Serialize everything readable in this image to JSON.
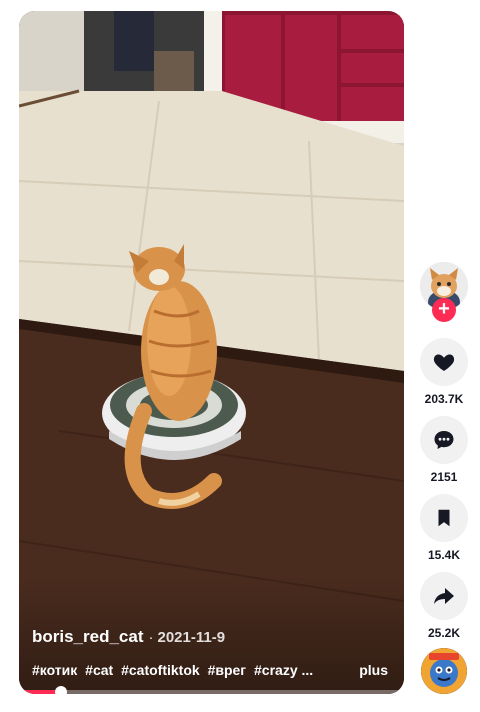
{
  "video": {
    "author": "boris_red_cat",
    "separator": "·",
    "date": "2021-11-9",
    "hashtags": [
      "#котик",
      "#cat",
      "#catoftiktok",
      "#врег",
      "#crazy ..."
    ],
    "more_label": "plus",
    "progress": 0.11
  },
  "actions": {
    "likes": "203.7K",
    "comments": "2151",
    "saves": "15.4K",
    "shares": "25.2K"
  },
  "icons": {
    "avatar": "cat-avatar",
    "follow": "plus-icon",
    "like": "heart-icon",
    "comment": "comment-icon",
    "save": "bookmark-icon",
    "share": "share-arrow-icon",
    "music": "music-disc-icon"
  },
  "colors": {
    "accent": "#fe2c55",
    "action_bg": "#f1f1f2",
    "text": "#161823"
  }
}
